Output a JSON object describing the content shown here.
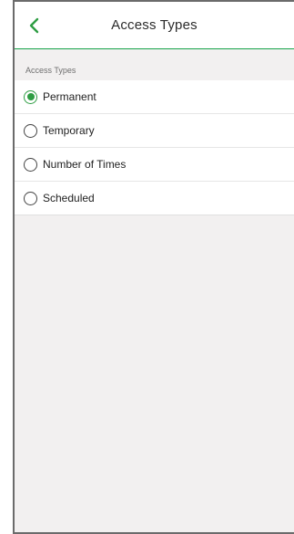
{
  "header": {
    "title": "Access Types"
  },
  "section": {
    "label": "Access Types"
  },
  "options": [
    {
      "label": "Permanent",
      "selected": true
    },
    {
      "label": "Temporary",
      "selected": false
    },
    {
      "label": "Number of Times",
      "selected": false
    },
    {
      "label": "Scheduled",
      "selected": false
    }
  ],
  "colors": {
    "accent": "#2e9d43",
    "header_border": "#16a34a",
    "background": "#f2f0f0"
  },
  "icons": {
    "back": "chevron-left-icon"
  }
}
